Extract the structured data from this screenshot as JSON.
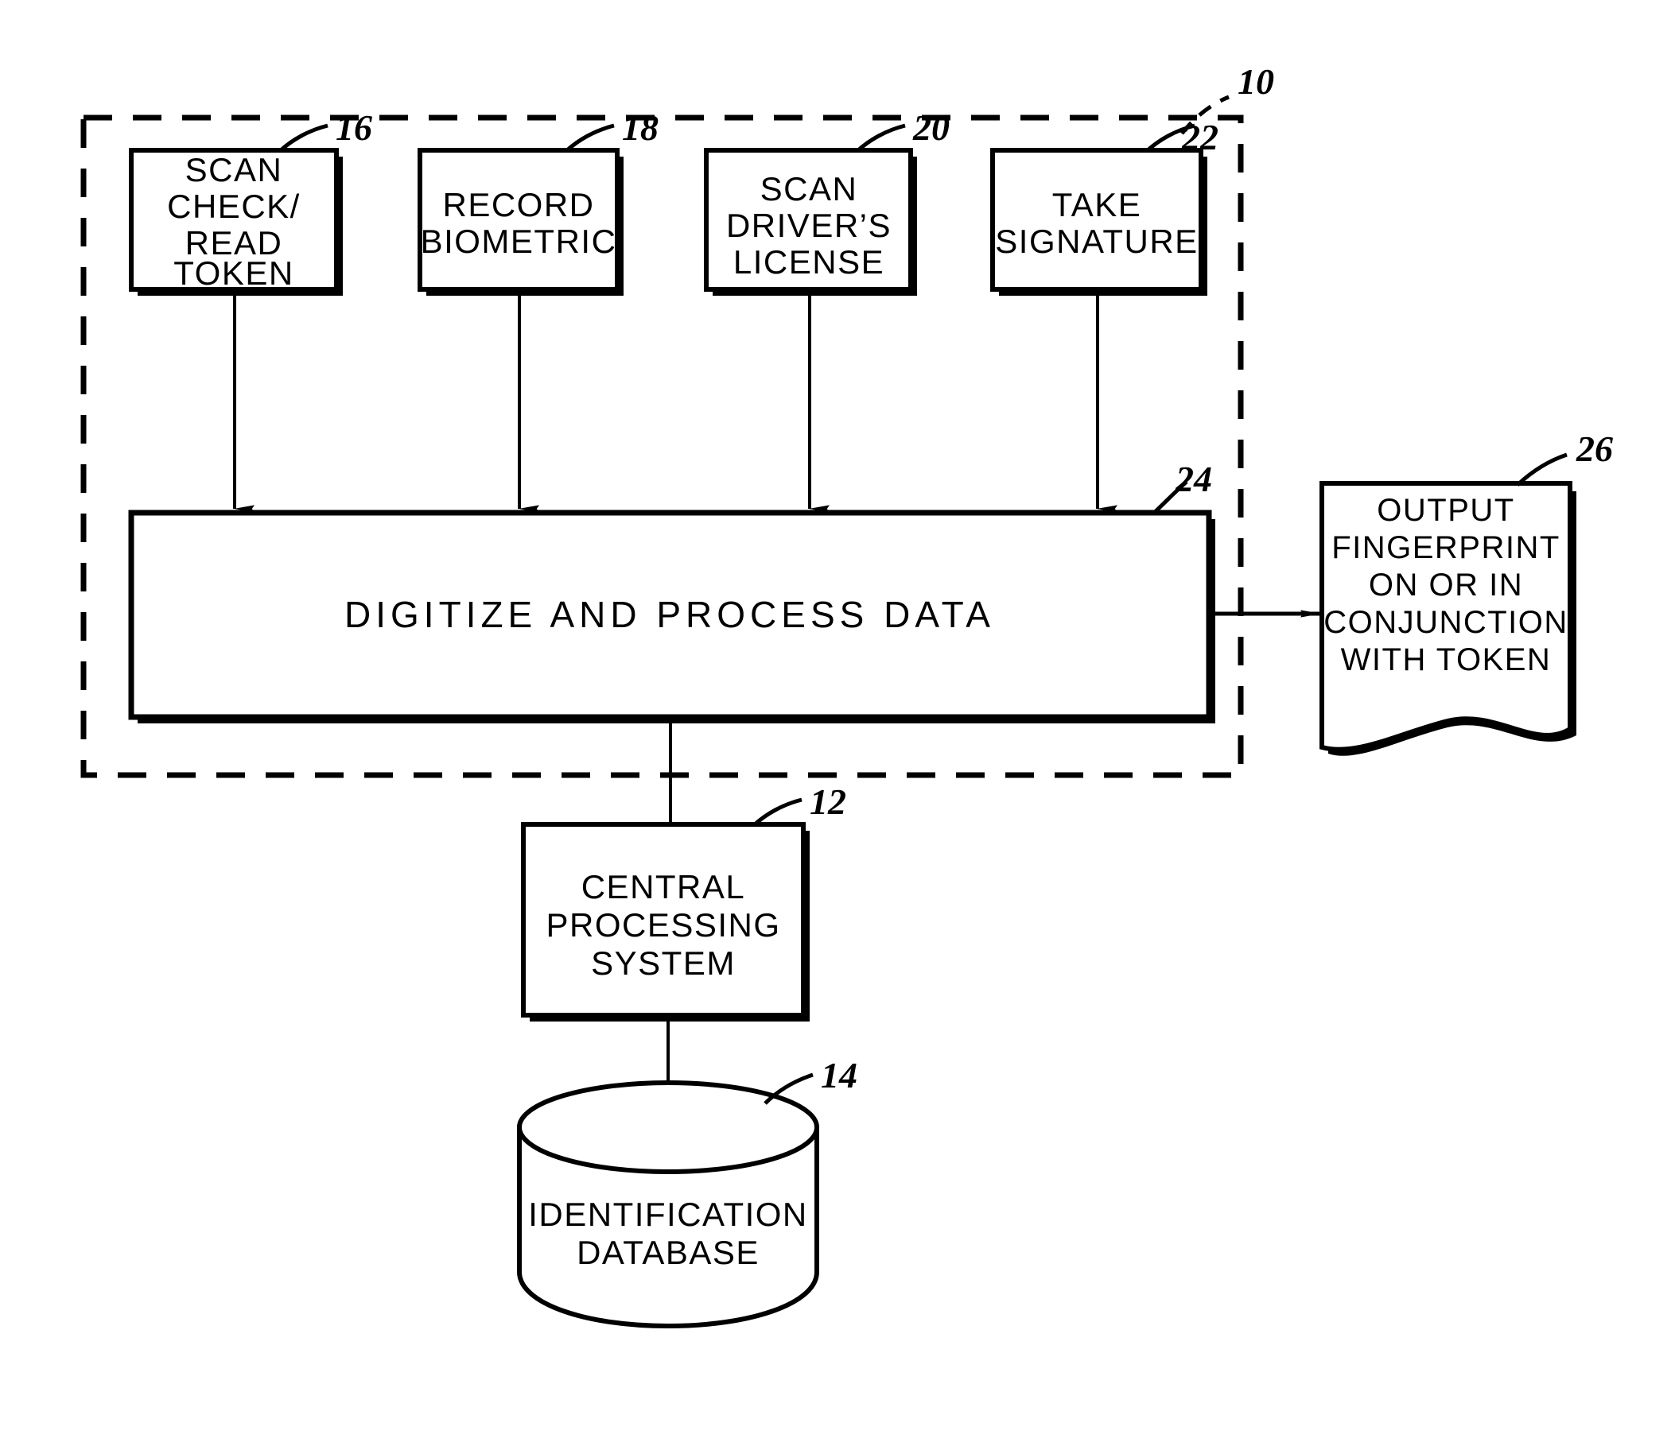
{
  "figure": {
    "kind": "patent-flow-diagram",
    "background_color": "#ffffff",
    "line_color": "#000000",
    "system_boundary": {
      "reference_number": "10",
      "style": "dashed",
      "name": "data-capture-system-boundary"
    }
  },
  "nodes": {
    "scan_check_read_token": {
      "reference_number": "16",
      "shape": "rectangle",
      "lines": [
        "SCAN",
        "CHECK/",
        "READ",
        "TOKEN"
      ]
    },
    "record_biometric": {
      "reference_number": "18",
      "shape": "rectangle",
      "lines": [
        "RECORD",
        "BIOMETRIC"
      ]
    },
    "scan_drivers_license": {
      "reference_number": "20",
      "shape": "rectangle",
      "lines": [
        "SCAN",
        "DRIVER’S",
        "LICENSE"
      ]
    },
    "take_signature": {
      "reference_number": "22",
      "shape": "rectangle",
      "lines": [
        "TAKE",
        "SIGNATURE"
      ]
    },
    "digitize_and_process_data": {
      "reference_number": "24",
      "shape": "rectangle",
      "lines": [
        "DIGITIZE  AND  PROCESS  DATA"
      ]
    },
    "output_fingerprint": {
      "reference_number": "26",
      "shape": "document",
      "lines": [
        "OUTPUT",
        "FINGERPRINT",
        "ON  OR  IN",
        "CONJUNCTION",
        "WITH  TOKEN"
      ]
    },
    "central_processing_system": {
      "reference_number": "12",
      "shape": "rectangle",
      "lines": [
        "CENTRAL",
        "PROCESSING",
        "SYSTEM"
      ]
    },
    "identification_database": {
      "reference_number": "14",
      "shape": "cylinder",
      "lines": [
        "IDENTIFICATION",
        "DATABASE"
      ]
    }
  },
  "connectors": [
    {
      "name": "token-to-digitize",
      "from": "scan_check_read_token",
      "to": "digitize_and_process_data",
      "direction": "down",
      "arrowhead": true
    },
    {
      "name": "biometric-to-digitize",
      "from": "record_biometric",
      "to": "digitize_and_process_data",
      "direction": "down",
      "arrowhead": true
    },
    {
      "name": "license-to-digitize",
      "from": "scan_drivers_license",
      "to": "digitize_and_process_data",
      "direction": "down",
      "arrowhead": true
    },
    {
      "name": "signature-to-digitize",
      "from": "take_signature",
      "to": "digitize_and_process_data",
      "direction": "down",
      "arrowhead": true
    },
    {
      "name": "digitize-to-output-fingerprint",
      "from": "digitize_and_process_data",
      "to": "output_fingerprint",
      "direction": "right",
      "arrowhead": true
    },
    {
      "name": "digitize-to-cps",
      "from": "digitize_and_process_data",
      "to": "central_processing_system",
      "direction": "down",
      "arrowhead": true
    },
    {
      "name": "cps-to-database",
      "from": "central_processing_system",
      "to": "identification_database",
      "direction": "down",
      "arrowhead": true
    }
  ]
}
